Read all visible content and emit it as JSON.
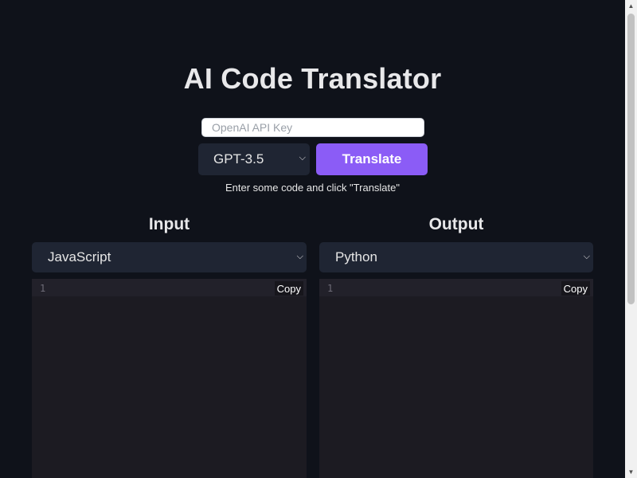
{
  "header": {
    "title": "AI Code Translator"
  },
  "controls": {
    "api_key_placeholder": "OpenAI API Key",
    "api_key_value": "",
    "model_selected": "GPT-3.5",
    "translate_label": "Translate",
    "hint": "Enter some code and click \"Translate\""
  },
  "input_panel": {
    "title": "Input",
    "language": "JavaScript",
    "line_number": "1",
    "copy_label": "Copy"
  },
  "output_panel": {
    "title": "Output",
    "language": "Python",
    "line_number": "1",
    "copy_label": "Copy"
  },
  "icons": {
    "select_chevron": "chevron-down-icon",
    "scroll_up": "arrow-up-icon",
    "scroll_down": "arrow-down-icon"
  },
  "colors": {
    "background": "#0f121a",
    "accent": "#8b5cf6",
    "select_bg": "#1f2533",
    "editor_bg": "#1c1b22"
  }
}
